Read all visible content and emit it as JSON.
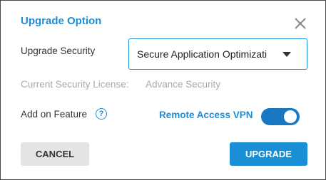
{
  "dialog": {
    "title": "Upgrade Option",
    "close_icon": "close-icon"
  },
  "upgrade_security": {
    "label": "Upgrade Security",
    "selected_value": "Secure Application Optimization"
  },
  "current_license": {
    "label": "Current Security License:",
    "value": "Advance Security"
  },
  "add_on": {
    "label": "Add on Feature",
    "help_icon": "help-icon",
    "help_glyph": "?",
    "feature_label": "Remote Access VPN",
    "feature_enabled": true
  },
  "actions": {
    "cancel_label": "CANCEL",
    "upgrade_label": "UPGRADE"
  },
  "colors": {
    "accent": "#1a8fd8",
    "toggle_on": "#1a78c2",
    "muted_text": "#a9a9a9",
    "cancel_bg": "#e4e4e4"
  }
}
